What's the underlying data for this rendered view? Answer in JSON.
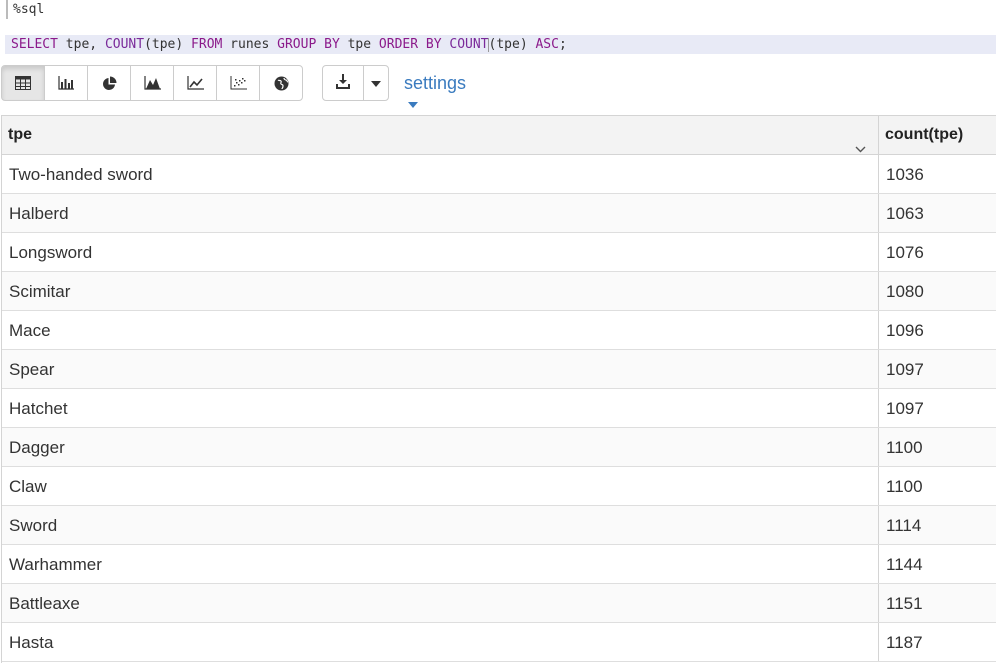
{
  "editor": {
    "magic": "%sql",
    "query_tokens": [
      {
        "t": "SELECT",
        "c": "kw"
      },
      {
        "t": " tpe, ",
        "c": ""
      },
      {
        "t": "COUNT",
        "c": "fn"
      },
      {
        "t": "(tpe) ",
        "c": ""
      },
      {
        "t": "FROM",
        "c": "kw"
      },
      {
        "t": " runes ",
        "c": ""
      },
      {
        "t": "GROUP BY",
        "c": "kw"
      },
      {
        "t": " tpe ",
        "c": ""
      },
      {
        "t": "ORDER BY",
        "c": "kw"
      },
      {
        "t": " ",
        "c": ""
      },
      {
        "t": "COUNT",
        "c": "fn"
      },
      {
        "t": "|",
        "c": "caret"
      },
      {
        "t": "(tpe) ",
        "c": ""
      },
      {
        "t": "ASC",
        "c": "kw"
      },
      {
        "t": ";",
        "c": ""
      }
    ]
  },
  "toolbar": {
    "visualizations": [
      {
        "name": "table-view-button",
        "icon": "table-icon",
        "active": true
      },
      {
        "name": "bar-chart-button",
        "icon": "bar-chart-icon",
        "active": false
      },
      {
        "name": "pie-chart-button",
        "icon": "pie-chart-icon",
        "active": false
      },
      {
        "name": "area-chart-button",
        "icon": "area-chart-icon",
        "active": false
      },
      {
        "name": "line-chart-button",
        "icon": "line-chart-icon",
        "active": false
      },
      {
        "name": "scatter-chart-button",
        "icon": "scatter-chart-icon",
        "active": false
      },
      {
        "name": "map-button",
        "icon": "globe-icon",
        "active": false
      }
    ],
    "download_icon": "download-icon",
    "dropdown_icon": "caret-down-icon",
    "settings_label": "settings"
  },
  "table": {
    "columns": [
      "tpe",
      "count(tpe)"
    ],
    "sort_icon": "chevron-down-icon",
    "rows": [
      [
        "Two-handed sword",
        "1036"
      ],
      [
        "Halberd",
        "1063"
      ],
      [
        "Longsword",
        "1076"
      ],
      [
        "Scimitar",
        "1080"
      ],
      [
        "Mace",
        "1096"
      ],
      [
        "Spear",
        "1097"
      ],
      [
        "Hatchet",
        "1097"
      ],
      [
        "Dagger",
        "1100"
      ],
      [
        "Claw",
        "1100"
      ],
      [
        "Sword",
        "1114"
      ],
      [
        "Warhammer",
        "1144"
      ],
      [
        "Battleaxe",
        "1151"
      ],
      [
        "Hasta",
        "1187"
      ]
    ]
  },
  "colors": {
    "accent": "#3a7bbf",
    "keyword": "#8b1a8b",
    "editor_highlight": "#e8eaf6"
  }
}
